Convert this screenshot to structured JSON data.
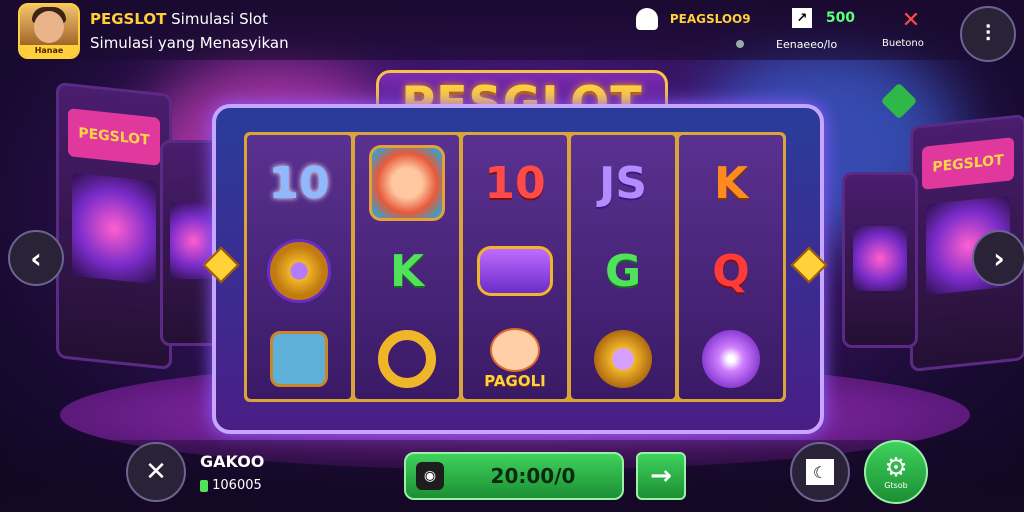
{
  "header": {
    "avatar_tag": "Hanae",
    "brand_name": "PEGSLOT",
    "brand_suffix": "Simulasi Slot",
    "subtitle": "Simulasi yang Menasyikan",
    "player_name": "PEAGSLOO9",
    "balance_value": "500",
    "balance_caption": "Eenaeeo/lo",
    "bonus_caption": "Buetono"
  },
  "game": {
    "title": "PESGLOT",
    "reels": [
      [
        "10",
        "swirl-coin",
        "robot"
      ],
      [
        "dog-face",
        "K",
        "gold-ring"
      ],
      [
        "10",
        "purple-coin",
        "PAGOLI"
      ],
      [
        "JS",
        "G",
        "gold-pot"
      ],
      [
        "K",
        "Q",
        "purple-gem"
      ]
    ]
  },
  "footer": {
    "label": "GAKOO",
    "credits": "106005",
    "spin_value": "20:00/0",
    "settings_caption": "Gtsob"
  },
  "colors": {
    "accent_gold": "#ffd23a",
    "spin_green": "#2fb74a",
    "frame_purple": "#4a1e86"
  }
}
